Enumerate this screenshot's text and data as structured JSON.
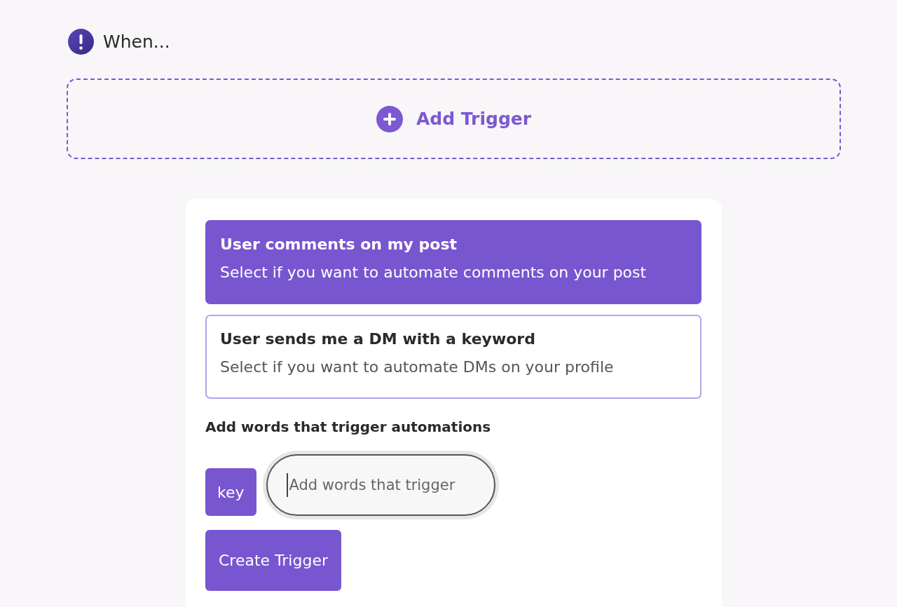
{
  "header": {
    "label": "When..."
  },
  "add_trigger": {
    "label": "Add Trigger"
  },
  "trigger_options": [
    {
      "title": "User comments on my post",
      "description": "Select if you want to automate comments on your post",
      "selected": true
    },
    {
      "title": "User sends me a DM with a keyword",
      "description": "Select if you want to automate DMs on your profile",
      "selected": false
    }
  ],
  "keywords": {
    "label": "Add words that trigger automations",
    "chips": [
      "key"
    ],
    "input": {
      "placeholder": "Add words that trigger",
      "focused": true
    }
  },
  "create_button": {
    "label": "Create Trigger"
  }
}
